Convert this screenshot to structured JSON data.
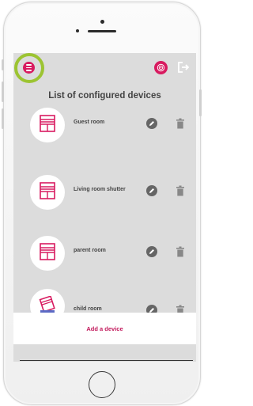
{
  "header": {
    "menu_icon": "hamburger-menu-icon",
    "profile_icon": "user-target-icon",
    "logout_icon": "logout-icon"
  },
  "title": "List of configured devices",
  "devices": [
    {
      "label": "Guest room",
      "icon": "window-shutter-icon"
    },
    {
      "label": "Living room shutter",
      "icon": "window-shutter-icon"
    },
    {
      "label": "parent room",
      "icon": "window-shutter-icon"
    },
    {
      "label": "child room",
      "icon": "tilted-window-icon"
    }
  ],
  "actions": {
    "edit_icon": "pencil-icon",
    "delete_icon": "trash-icon"
  },
  "add_device_label": "Add a device",
  "colors": {
    "accent": "#d81b60",
    "highlight": "#9cc432",
    "screen_bg": "#dcdcdc",
    "icon_gray": "#666666"
  }
}
